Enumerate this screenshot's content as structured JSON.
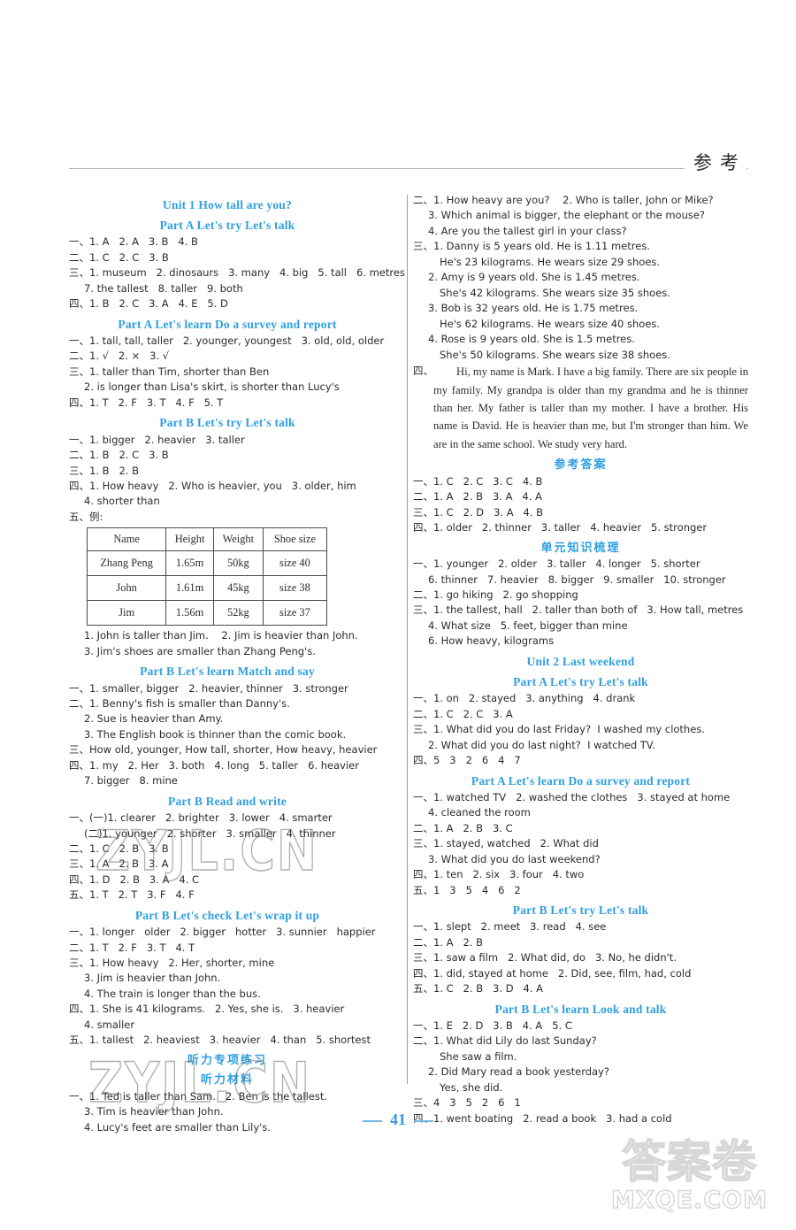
{
  "header": {
    "title": "参考"
  },
  "page_number": {
    "value": "41"
  },
  "watermarks": {
    "left_upper": "ZYJL.CN",
    "left_lower": "ZYJL.CN",
    "corner_cn": "答案卷",
    "corner_en": "MXQE.COM"
  },
  "left_column": [
    {
      "type": "heading",
      "text": "Unit 1   How tall are you?"
    },
    {
      "type": "heading",
      "text": "Part A   Let's try   Let's talk"
    },
    {
      "type": "line",
      "text": "一、1. A   2. A   3. B   4. B"
    },
    {
      "type": "line",
      "text": "二、1. C   2. C   3. B"
    },
    {
      "type": "line",
      "text": "三、1. museum   2. dinosaurs   3. many   4. big   5. tall   6. metres"
    },
    {
      "type": "line",
      "indent": 1,
      "text": "7. the tallest   8. taller   9. both"
    },
    {
      "type": "line",
      "text": "四、1. B   2. C   3. A   4. E   5. D"
    },
    {
      "type": "heading",
      "text": "Part A   Let's learn   Do a survey and report"
    },
    {
      "type": "line",
      "text": "一、1. tall, tall, taller   2. younger, youngest   3. old, old, older"
    },
    {
      "type": "line",
      "text": "二、1. √   2. ×   3. √"
    },
    {
      "type": "line",
      "text": "三、1. taller than Tim, shorter than Ben"
    },
    {
      "type": "line",
      "indent": 1,
      "text": "2. is longer than Lisa's skirt, is shorter than Lucy's"
    },
    {
      "type": "line",
      "text": "四、1. T   2. F   3. T   4. F   5. T"
    },
    {
      "type": "heading",
      "text": "Part B   Let's try   Let's talk"
    },
    {
      "type": "line",
      "text": "一、1. bigger   2. heavier   3. taller"
    },
    {
      "type": "line",
      "text": "二、1. B   2. C   3. B"
    },
    {
      "type": "line",
      "text": "三、1. B   2. B"
    },
    {
      "type": "line",
      "text": "四、1. How heavy   2. Who is heavier, you   3. older, him"
    },
    {
      "type": "line",
      "indent": 1,
      "text": "4. shorter than"
    },
    {
      "type": "line",
      "text": "五、例:"
    },
    {
      "type": "table"
    },
    {
      "type": "line",
      "indent": 1,
      "text": "1. John is taller than Jim.    2. Jim is heavier than John."
    },
    {
      "type": "line",
      "indent": 1,
      "text": "3. Jim's shoes are smaller than Zhang Peng's."
    },
    {
      "type": "heading",
      "text": "Part B   Let's learn   Match and say"
    },
    {
      "type": "line",
      "text": "一、1. smaller, bigger   2. heavier, thinner   3. stronger"
    },
    {
      "type": "line",
      "text": "二、1. Benny's fish is smaller than Danny's."
    },
    {
      "type": "line",
      "indent": 1,
      "text": "2. Sue is heavier than Amy."
    },
    {
      "type": "line",
      "indent": 1,
      "text": "3. The English book is thinner than the comic book."
    },
    {
      "type": "line",
      "text": "三、How old, younger, How tall, shorter, How heavy, heavier"
    },
    {
      "type": "line",
      "text": "四、1. my   2. Her   3. both   4. long   5. taller   6. heavier"
    },
    {
      "type": "line",
      "indent": 1,
      "text": "7. bigger   8. mine"
    },
    {
      "type": "heading",
      "text": "Part B   Read and write"
    },
    {
      "type": "line",
      "text": "一、(一)1. clearer   2. brighter   3. lower   4. smarter"
    },
    {
      "type": "line",
      "indent": 1,
      "text": "(二)1. younger   2. shorter   3. smaller   4. thinner"
    },
    {
      "type": "line",
      "text": "二、1. C   2. B   3. B"
    },
    {
      "type": "line",
      "text": "三、1. A   2. B   3. A"
    },
    {
      "type": "line",
      "text": "四、1. D   2. B   3. A   4. C"
    },
    {
      "type": "line",
      "text": "五、1. T   2. T   3. F   4. F"
    },
    {
      "type": "heading",
      "text": "Part B   Let's check   Let's wrap it up"
    },
    {
      "type": "line",
      "text": "一、1. longer   older   2. bigger   hotter   3. sunnier   happier"
    },
    {
      "type": "line",
      "text": "二、1. T   2. F   3. T   4. T"
    },
    {
      "type": "line",
      "text": "三、1. How heavy   2. Her, shorter, mine"
    },
    {
      "type": "line",
      "indent": 1,
      "text": "3. Jim is heavier than John."
    },
    {
      "type": "line",
      "indent": 1,
      "text": "4. The train is longer than the bus."
    },
    {
      "type": "line",
      "text": "四、1. She is 41 kilograms.   2. Yes, she is.   3. heavier"
    },
    {
      "type": "line",
      "indent": 1,
      "text": "4. smaller"
    },
    {
      "type": "line",
      "text": "五、1. tallest   2. heaviest   3. heavier   4. than   5. shortest"
    },
    {
      "type": "heading_cn",
      "text": "听力专项练习"
    },
    {
      "type": "heading_cn",
      "text": "听力材料"
    },
    {
      "type": "line",
      "text": "一、1. Ted is taller than Sam.   2. Ben is the tallest."
    },
    {
      "type": "line",
      "indent": 1,
      "text": "3. Tim is heavier than John."
    },
    {
      "type": "line",
      "indent": 1,
      "text": "4. Lucy's feet are smaller than Lily's."
    }
  ],
  "table": {
    "headers": [
      "Name",
      "Height",
      "Weight",
      "Shoe size"
    ],
    "rows": [
      [
        "Zhang Peng",
        "1.65m",
        "50kg",
        "size 40"
      ],
      [
        "John",
        "1.61m",
        "45kg",
        "size 38"
      ],
      [
        "Jim",
        "1.56m",
        "52kg",
        "size 37"
      ]
    ]
  },
  "right_column": [
    {
      "type": "line",
      "text": "二、1. How heavy are you?    2. Who is taller, John or Mike?"
    },
    {
      "type": "line",
      "indent": 1,
      "text": "3. Which animal is bigger, the elephant or the mouse?"
    },
    {
      "type": "line",
      "indent": 1,
      "text": "4. Are you the tallest girl in your class?"
    },
    {
      "type": "line",
      "text": "三、1. Danny is 5 years old. He is 1.11 metres."
    },
    {
      "type": "line",
      "indent": 2,
      "text": "He's 23 kilograms. He wears size 29 shoes."
    },
    {
      "type": "line",
      "indent": 1,
      "text": "2. Amy is 9 years old. She is 1.45 metres."
    },
    {
      "type": "line",
      "indent": 2,
      "text": "She's 42 kilograms. She wears size 35 shoes."
    },
    {
      "type": "line",
      "indent": 1,
      "text": "3. Bob is 32 years old. He is 1.75 metres."
    },
    {
      "type": "line",
      "indent": 2,
      "text": "He's 62 kilograms. He wears size 40 shoes."
    },
    {
      "type": "line",
      "indent": 1,
      "text": "4. Rose is 9 years old. She is 1.5 metres."
    },
    {
      "type": "line",
      "indent": 2,
      "text": "She's 50 kilograms. She wears size 38 shoes."
    },
    {
      "type": "paragraph",
      "key": "四、",
      "text": "Hi, my name is Mark. I have a big family. There are six people in my family. My grandpa is older than my grandma and he is thinner than her. My father is taller than my mother. I have a brother. His name is David. He is heavier than me, but I'm stronger than him. We are in the same school. We study very hard."
    },
    {
      "type": "heading_cn",
      "text": "参考答案"
    },
    {
      "type": "line",
      "text": "一、1. C   2. C   3. C   4. B"
    },
    {
      "type": "line",
      "text": "二、1. A   2. B   3. A   4. A"
    },
    {
      "type": "line",
      "text": "三、1. C   2. D   3. A   4. B"
    },
    {
      "type": "line",
      "text": "四、1. older   2. thinner   3. taller   4. heavier   5. stronger"
    },
    {
      "type": "heading_cn",
      "text": "单元知识梳理"
    },
    {
      "type": "line",
      "text": "一、1. younger   2. older   3. taller   4. longer   5. shorter"
    },
    {
      "type": "line",
      "indent": 1,
      "text": "6. thinner   7. heavier   8. bigger   9. smaller   10. stronger"
    },
    {
      "type": "line",
      "text": "二、1. go hiking   2. go shopping"
    },
    {
      "type": "line",
      "text": "三、1. the tallest, hall   2. taller than both of   3. How tall, metres"
    },
    {
      "type": "line",
      "indent": 1,
      "text": "4. What size   5. feet, bigger than mine"
    },
    {
      "type": "line",
      "indent": 1,
      "text": "6. How heavy, kilograms"
    },
    {
      "type": "heading",
      "text": "Unit 2   Last weekend"
    },
    {
      "type": "heading",
      "text": "Part A   Let's try   Let's talk"
    },
    {
      "type": "line",
      "text": "一、1. on   2. stayed   3. anything   4. drank"
    },
    {
      "type": "line",
      "text": "二、1. C   2. C   3. A"
    },
    {
      "type": "line",
      "text": "三、1. What did you do last Friday?  I washed my clothes."
    },
    {
      "type": "line",
      "indent": 1,
      "text": "2. What did you do last night?  I watched TV."
    },
    {
      "type": "line",
      "text": "四、5   3   2   6   4   7"
    },
    {
      "type": "heading",
      "text": "Part A   Let's learn   Do a survey and report"
    },
    {
      "type": "line",
      "text": "一、1. watched TV   2. washed the clothes   3. stayed at home"
    },
    {
      "type": "line",
      "indent": 1,
      "text": "4. cleaned the room"
    },
    {
      "type": "line",
      "text": "二、1. A   2. B   3. C"
    },
    {
      "type": "line",
      "text": "三、1. stayed, watched   2. What did"
    },
    {
      "type": "line",
      "indent": 1,
      "text": "3. What did you do last weekend?"
    },
    {
      "type": "line",
      "text": "四、1. ten   2. six   3. four   4. two"
    },
    {
      "type": "line",
      "text": "五、1   3   5   4   6   2"
    },
    {
      "type": "heading",
      "text": "Part B   Let's try   Let's talk"
    },
    {
      "type": "line",
      "text": "一、1. slept   2. meet   3. read   4. see"
    },
    {
      "type": "line",
      "text": "二、1. A   2. B"
    },
    {
      "type": "line",
      "text": "三、1. saw a film   2. What did, do   3. No, he didn't."
    },
    {
      "type": "line",
      "text": "四、1. did, stayed at home   2. Did, see, film, had, cold"
    },
    {
      "type": "line",
      "text": "五、1. C   2. B   3. D   4. A"
    },
    {
      "type": "heading",
      "text": "Part B   Let's learn   Look and talk"
    },
    {
      "type": "line",
      "text": "一、1. E   2. D   3. B   4. A   5. C"
    },
    {
      "type": "line",
      "text": "二、1. What did Lily do last Sunday?"
    },
    {
      "type": "line",
      "indent": 2,
      "text": "She saw a film."
    },
    {
      "type": "line",
      "indent": 1,
      "text": "2. Did Mary read a book yesterday?"
    },
    {
      "type": "line",
      "indent": 2,
      "text": "Yes, she did."
    },
    {
      "type": "line",
      "text": "三、4   3   5   2   6   1"
    },
    {
      "type": "line",
      "text": "四、1. went boating   2. read a book   3. had a cold"
    }
  ]
}
